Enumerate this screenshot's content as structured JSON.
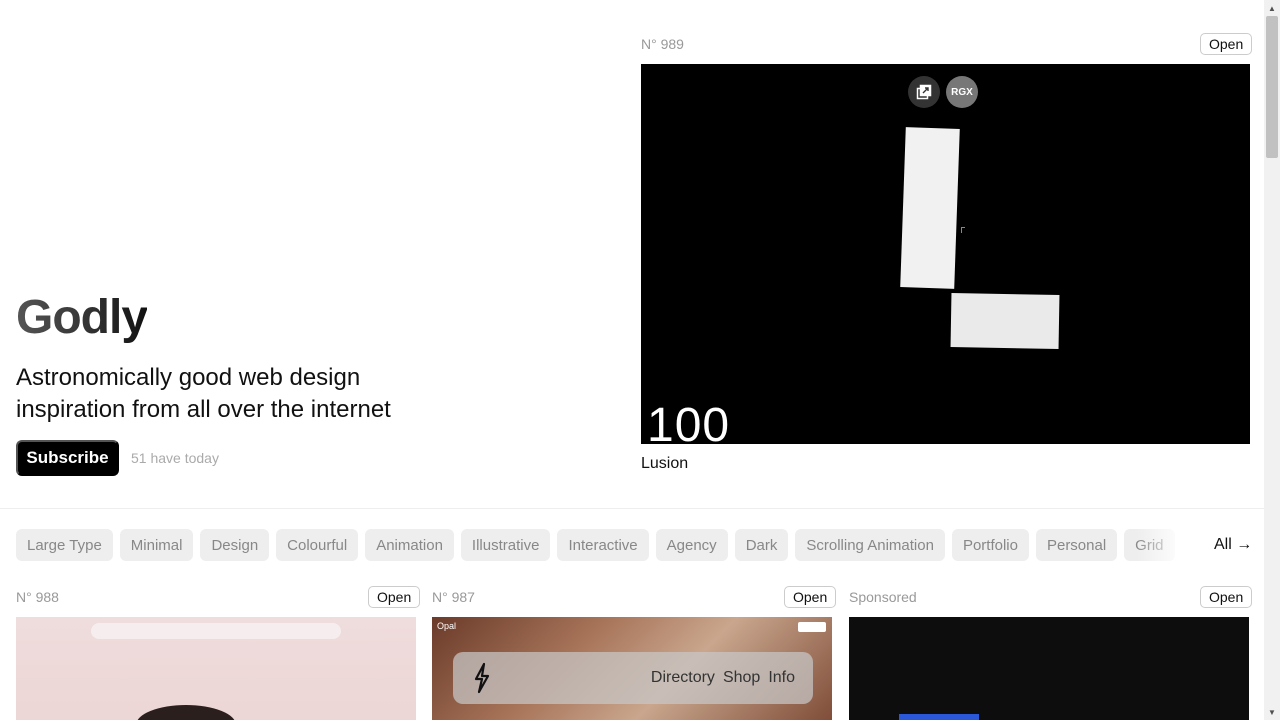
{
  "hero": {
    "title": "Godly",
    "tagline": "Astronomically good web design inspiration from all over the internet",
    "subscribe_label": "Subscribe",
    "subscriber_note": "51 have today"
  },
  "featured": {
    "number": "N° 989",
    "open_label": "Open",
    "name": "Lusion",
    "preview_big_text": "100",
    "rgx_label": "RGX"
  },
  "tags": [
    "Large Type",
    "Minimal",
    "Design",
    "Colourful",
    "Animation",
    "Illustrative",
    "Interactive",
    "Agency",
    "Dark",
    "Scrolling Animation",
    "Portfolio",
    "Personal",
    "Grid"
  ],
  "all_link": "All →",
  "cards": [
    {
      "number": "N° 988",
      "open_label": "Open"
    },
    {
      "number": "N° 987",
      "open_label": "Open",
      "preview_logo": "Opal"
    },
    {
      "number": "Sponsored",
      "open_label": "Open"
    }
  ],
  "nav": {
    "links": [
      "Directory",
      "Shop",
      "Info"
    ]
  },
  "icons": {
    "logo": "lightning-bolt-icon",
    "copy": "copy-icon"
  },
  "colors": {
    "primary": "#000000",
    "background": "#ffffff",
    "tag_bg": "#eeeeee",
    "muted_text": "#999999"
  }
}
